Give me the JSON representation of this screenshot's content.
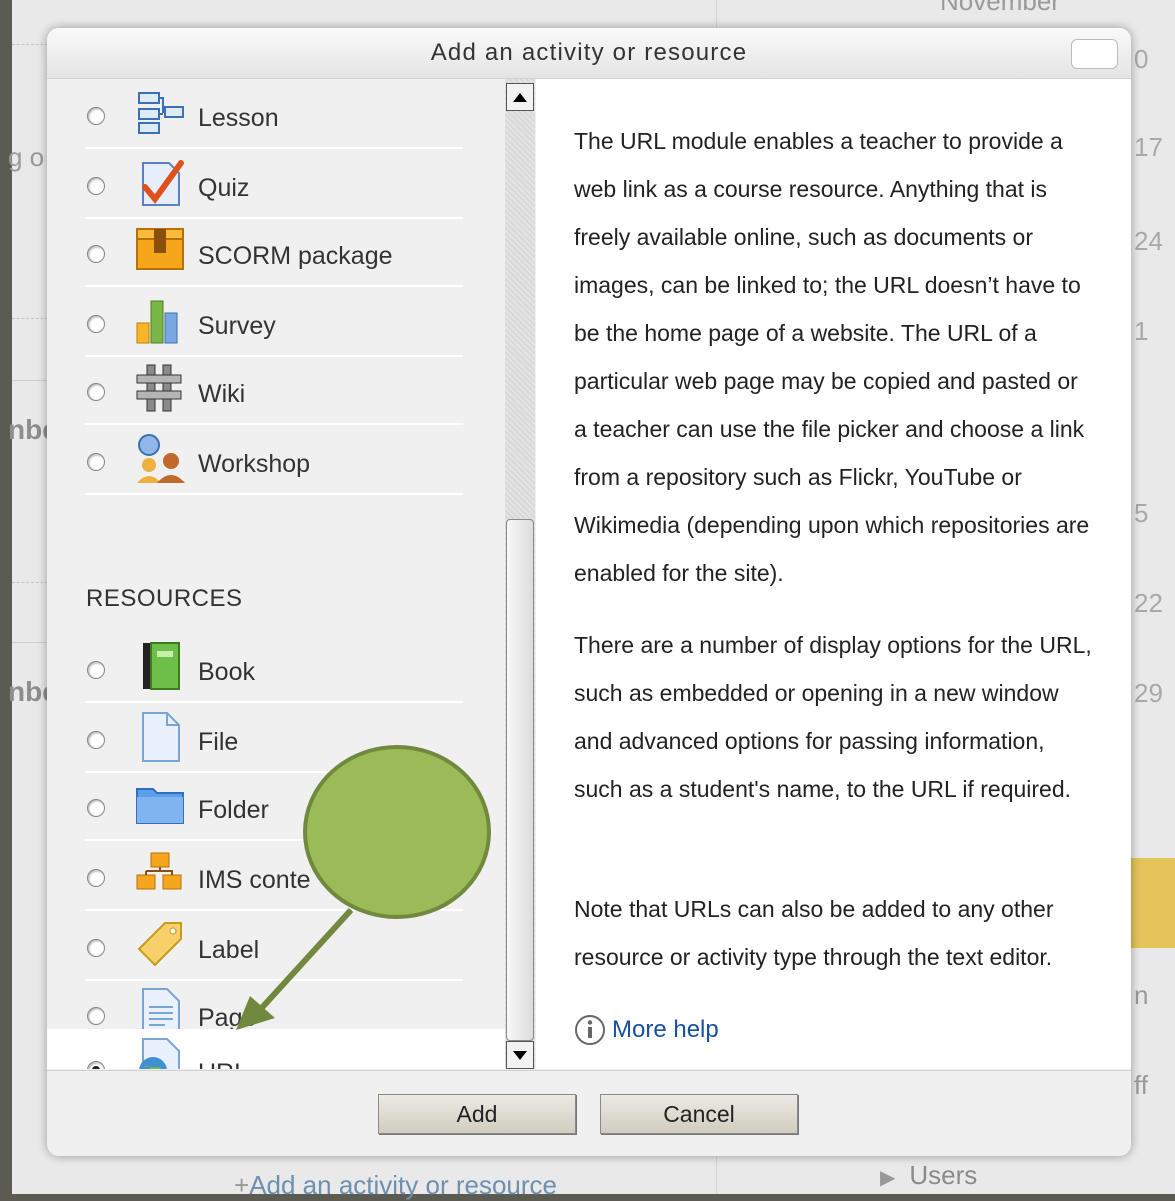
{
  "background": {
    "month_label": "November",
    "calendar_numbers": [
      "0",
      "17",
      "24",
      "1",
      "5",
      "22",
      "29"
    ],
    "partial_texts": [
      "g o",
      "nbe",
      "nbe",
      "n",
      "ff"
    ],
    "bottom_link": "Add an activity or resource",
    "users_label": "Users"
  },
  "dialog": {
    "title": "Add an activity or resource",
    "activities": [
      {
        "label": "Lesson",
        "icon": "lesson-icon"
      },
      {
        "label": "Quiz",
        "icon": "quiz-icon"
      },
      {
        "label": "SCORM package",
        "icon": "scorm-icon"
      },
      {
        "label": "Survey",
        "icon": "survey-icon"
      },
      {
        "label": "Wiki",
        "icon": "wiki-icon"
      },
      {
        "label": "Workshop",
        "icon": "workshop-icon"
      }
    ],
    "resources_heading": "RESOURCES",
    "resources": [
      {
        "label": "Book",
        "icon": "book-icon"
      },
      {
        "label": "File",
        "icon": "file-icon"
      },
      {
        "label": "Folder",
        "icon": "folder-icon"
      },
      {
        "label": "IMS conte",
        "icon": "ims-content-icon"
      },
      {
        "label": "Label",
        "icon": "label-icon"
      },
      {
        "label": "Page",
        "icon": "page-icon"
      },
      {
        "label": "URL",
        "icon": "url-globe-icon",
        "selected": true
      }
    ],
    "description": [
      "The URL module enables a teacher to provide a web link as a course resource. Anything that is freely available online, such as documents or images, can be linked to; the URL doesn’t have to be the home page of a website. The URL of a particular web page may be copied and pasted or a teacher can use the file picker and choose a link from a repository such as Flickr, YouTube or Wikimedia (depending upon which repositories are enabled for the site).",
      "There are a number of display options for the URL, such as embedded or opening in a new window and advanced options for passing information, such as a student's name, to the URL if required.",
      "Note that URLs can also be added to any other resource or activity type through the text editor."
    ],
    "more_help": "More help",
    "add_label": "Add",
    "cancel_label": "Cancel"
  },
  "colors": {
    "annotation_green": "#9bbb59",
    "annotation_stroke": "#71893f",
    "link_blue": "#1a4fa0"
  }
}
